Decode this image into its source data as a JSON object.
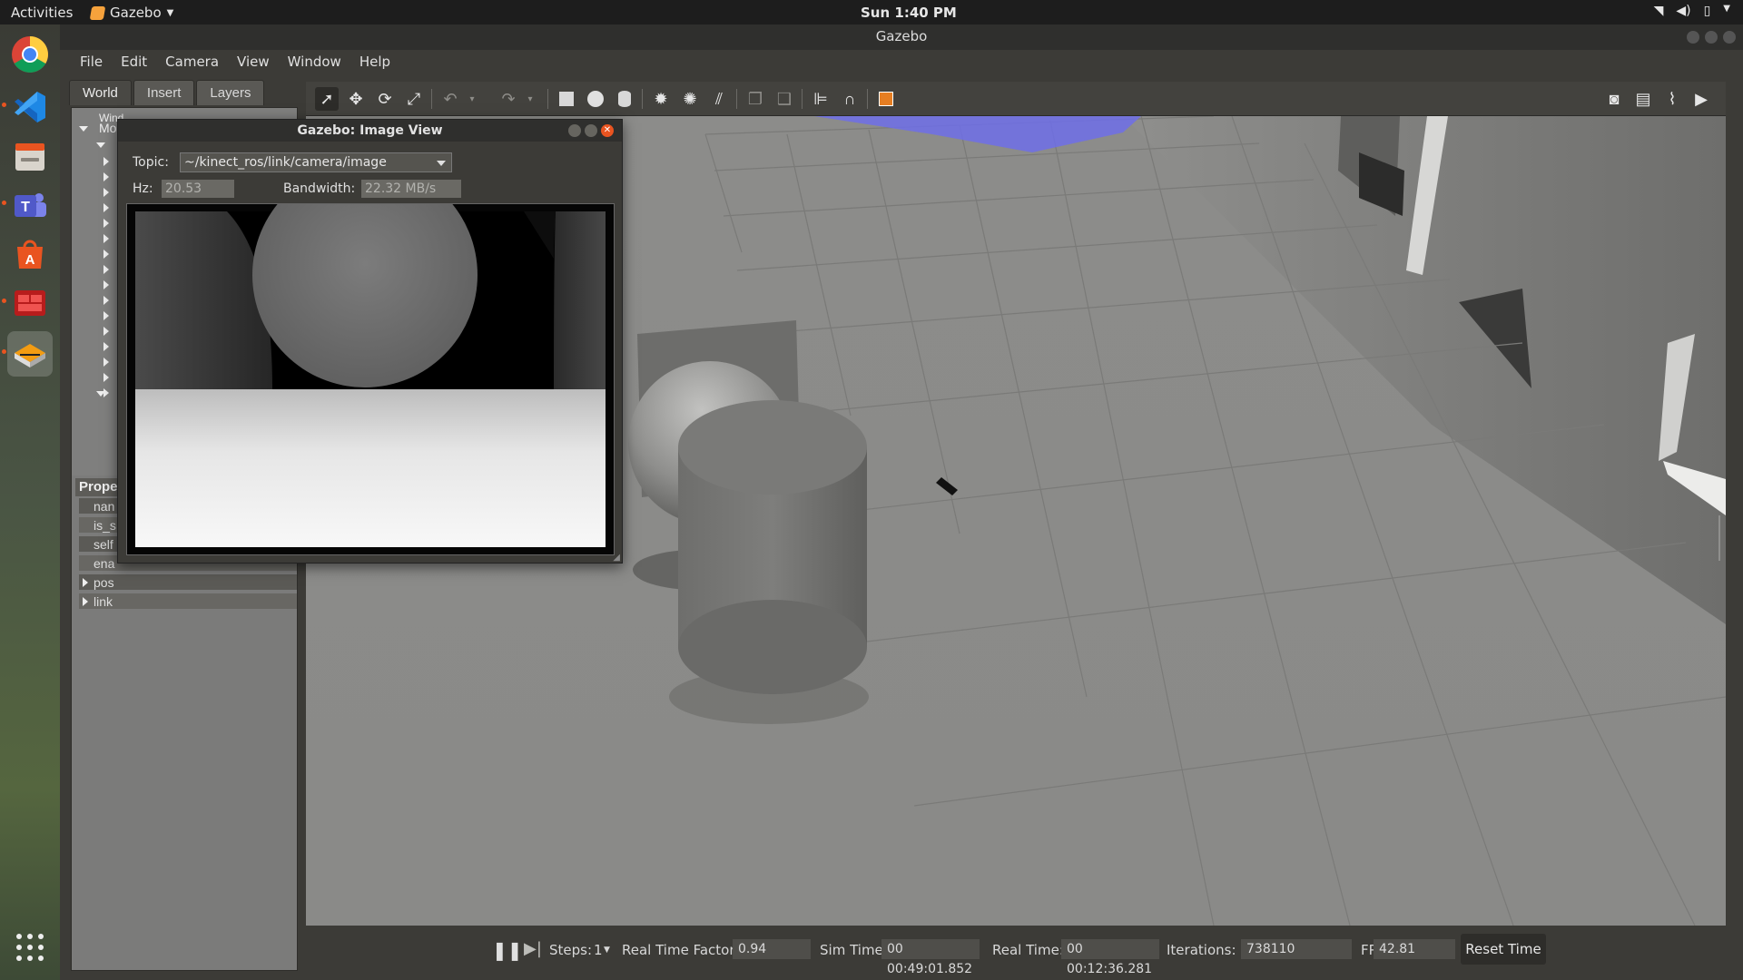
{
  "topbar": {
    "activities": "Activities",
    "app_name": "Gazebo",
    "clock": "Sun  1:40 PM"
  },
  "window": {
    "title": "Gazebo"
  },
  "menubar": {
    "items": [
      "File",
      "Edit",
      "Camera",
      "View",
      "Window",
      "Help"
    ]
  },
  "left_panel": {
    "tabs": [
      "World",
      "Insert",
      "Layers"
    ],
    "active_tab": "World",
    "tree": {
      "items": [
        "Wind",
        "Mo"
      ]
    },
    "properties": {
      "header": "Proper",
      "rows": [
        "nan",
        "is_s",
        "self",
        "ena",
        "pos",
        "link"
      ]
    }
  },
  "image_view": {
    "title": "Gazebo: Image View",
    "topic_label": "Topic:",
    "topic_value": "~/kinect_ros/link/camera/image",
    "hz_label": "Hz:",
    "hz_value": "20.53",
    "bandwidth_label": "Bandwidth:",
    "bandwidth_value": "22.32 MB/s"
  },
  "bottombar": {
    "steps_label": "Steps:",
    "steps_value": "1",
    "rtf_label": "Real Time Factor:",
    "rtf_value": "0.94",
    "sim_time_label": "Sim Time:",
    "sim_time_value": "00 00:49:01.852",
    "real_time_label": "Real Time:",
    "real_time_value": "00 00:12:36.281",
    "iterations_label": "Iterations:",
    "iterations_value": "738110",
    "fps_label": "FPS:",
    "fps_value": "42.81",
    "reset_label": "Reset Time"
  },
  "icons": {
    "dock": [
      "chrome-icon",
      "vscode-icon",
      "files-icon",
      "teams-icon",
      "software-center-icon",
      "terminal-app-icon",
      "gazebo-icon",
      "show-apps-icon"
    ],
    "toolbar": [
      "select-icon",
      "translate-icon",
      "rotate-icon",
      "scale-icon",
      "undo-icon",
      "redo-icon",
      "box-icon",
      "sphere-icon",
      "cylinder-icon",
      "point-light-icon",
      "spot-light-icon",
      "directional-light-icon",
      "copy-icon",
      "paste-icon",
      "align-icon",
      "snap-icon",
      "view-angle-icon",
      "screenshot-icon",
      "log-icon",
      "plot-icon",
      "record-icon"
    ]
  },
  "colors": {
    "accent": "#e95420",
    "laser": "#6f6fe8"
  }
}
